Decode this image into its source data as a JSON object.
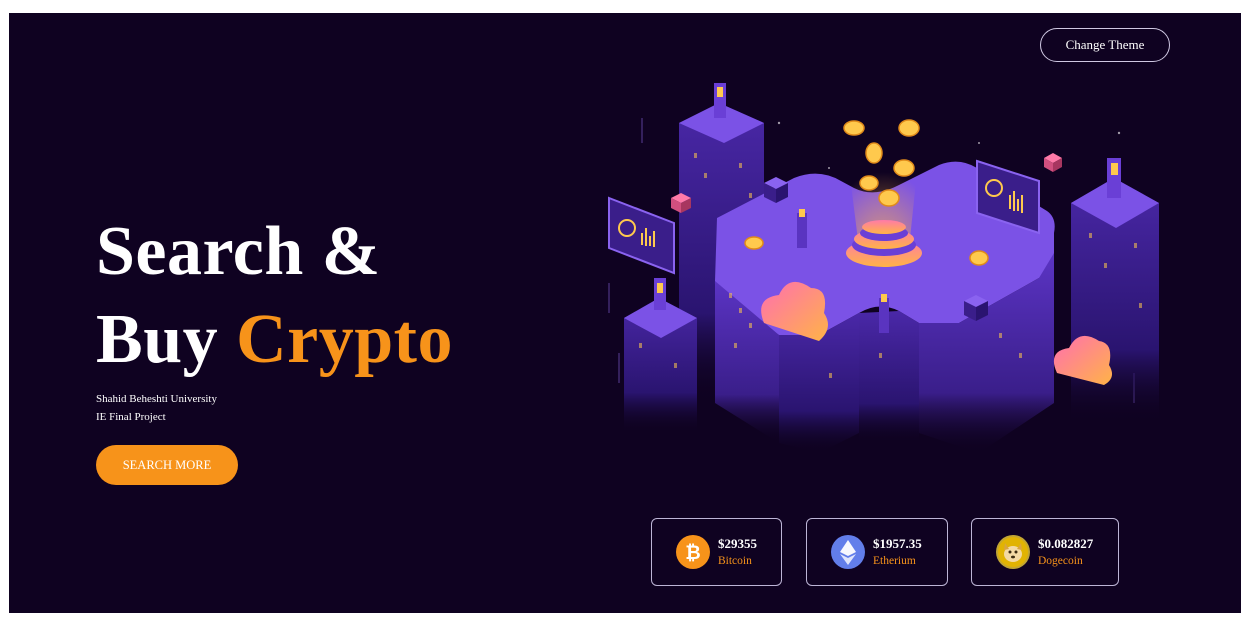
{
  "header": {
    "theme_button": "Change Theme"
  },
  "hero": {
    "title_line1": "Search &",
    "title_line2_prefix": "Buy",
    "title_line2_accent": "Crypto",
    "subtitle_line1": "Shahid Beheshti University",
    "subtitle_line2": "IE Final Project",
    "cta_label": "SEARCH MORE"
  },
  "illustration": {
    "icon": "isometric-crypto-city-illustration"
  },
  "coins": [
    {
      "price": "$29355",
      "name": "Bitcoin",
      "icon": "bitcoin-icon",
      "color": "#f7931a"
    },
    {
      "price": "$1957.35",
      "name": "Etherium",
      "icon": "ethereum-icon",
      "color": "#627eea"
    },
    {
      "price": "$0.082827",
      "name": "Dogecoin",
      "icon": "dogecoin-icon",
      "color": "#c2a633"
    }
  ],
  "colors": {
    "background": "#0f0221",
    "accent": "#f7931a",
    "illustration_purple": "#6a3fd6"
  }
}
